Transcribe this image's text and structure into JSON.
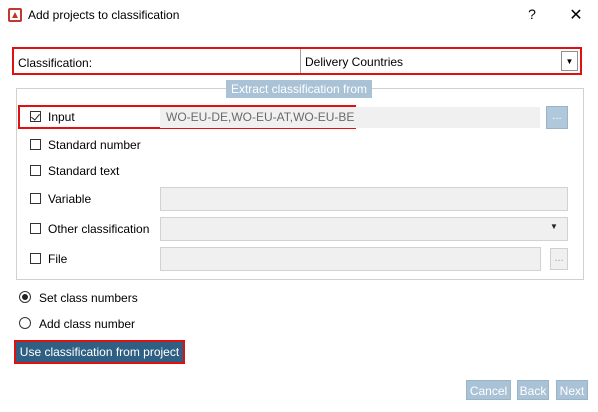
{
  "window": {
    "title": "Add projects to classification",
    "help_label": "?",
    "close_label": "✕"
  },
  "classification": {
    "label": "Classification:",
    "value": "Delivery Countries"
  },
  "group": {
    "legend": "Extract classification from",
    "options": {
      "input": {
        "label": "Input",
        "checked": true,
        "value": "WO-EU-DE,WO-EU-AT,WO-EU-BE"
      },
      "standard_number": {
        "label": "Standard number",
        "checked": false
      },
      "standard_text": {
        "label": "Standard text",
        "checked": false
      },
      "variable": {
        "label": "Variable",
        "checked": false
      },
      "other_classification": {
        "label": "Other classification",
        "checked": false
      },
      "file": {
        "label": "File",
        "checked": false
      }
    },
    "browse_label": "...",
    "file_browse_label": "..."
  },
  "mode": {
    "set_class_numbers": "Set class numbers",
    "add_class_number": "Add class number",
    "selected": "set_class_numbers"
  },
  "use_from_project_label": "Use classification from project",
  "footer": {
    "cancel": "Cancel",
    "back": "Back",
    "next": "Next"
  },
  "colors": {
    "accent": "#2f5f82",
    "disabled_button": "#a9c2d6",
    "highlight": "#e01010"
  }
}
